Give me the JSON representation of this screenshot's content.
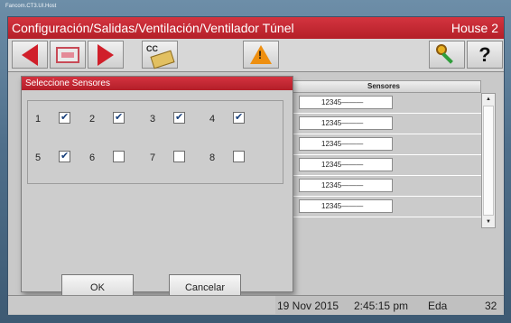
{
  "window": {
    "title": "Fancom.CT3.UI.Host"
  },
  "header": {
    "path": "Configuración/Salidas/Ventilación/Ventilador Túnel",
    "house": "House 2"
  },
  "toolbar": {
    "cc_label": "CC",
    "warning_glyph": "!",
    "help_glyph": "?"
  },
  "dialog": {
    "title": "Seleccione Sensores",
    "sensors": [
      {
        "num": "1",
        "checked": true
      },
      {
        "num": "2",
        "checked": true
      },
      {
        "num": "3",
        "checked": true
      },
      {
        "num": "4",
        "checked": true
      },
      {
        "num": "5",
        "checked": true
      },
      {
        "num": "6",
        "checked": false
      },
      {
        "num": "7",
        "checked": false
      },
      {
        "num": "8",
        "checked": false
      }
    ],
    "ok_label": "OK",
    "cancel_label": "Cancelar"
  },
  "sensors_table": {
    "header": "Sensores",
    "rows": [
      "12345———",
      "12345———",
      "12345———",
      "12345———",
      "12345———",
      "12345———"
    ]
  },
  "status": {
    "date": "19 Nov 2015",
    "time": "2:45:15 pm",
    "age_label": "Eda",
    "age_value": "32"
  },
  "colors": {
    "accent_red": "#c42a33",
    "warning_orange": "#ee8f10"
  }
}
